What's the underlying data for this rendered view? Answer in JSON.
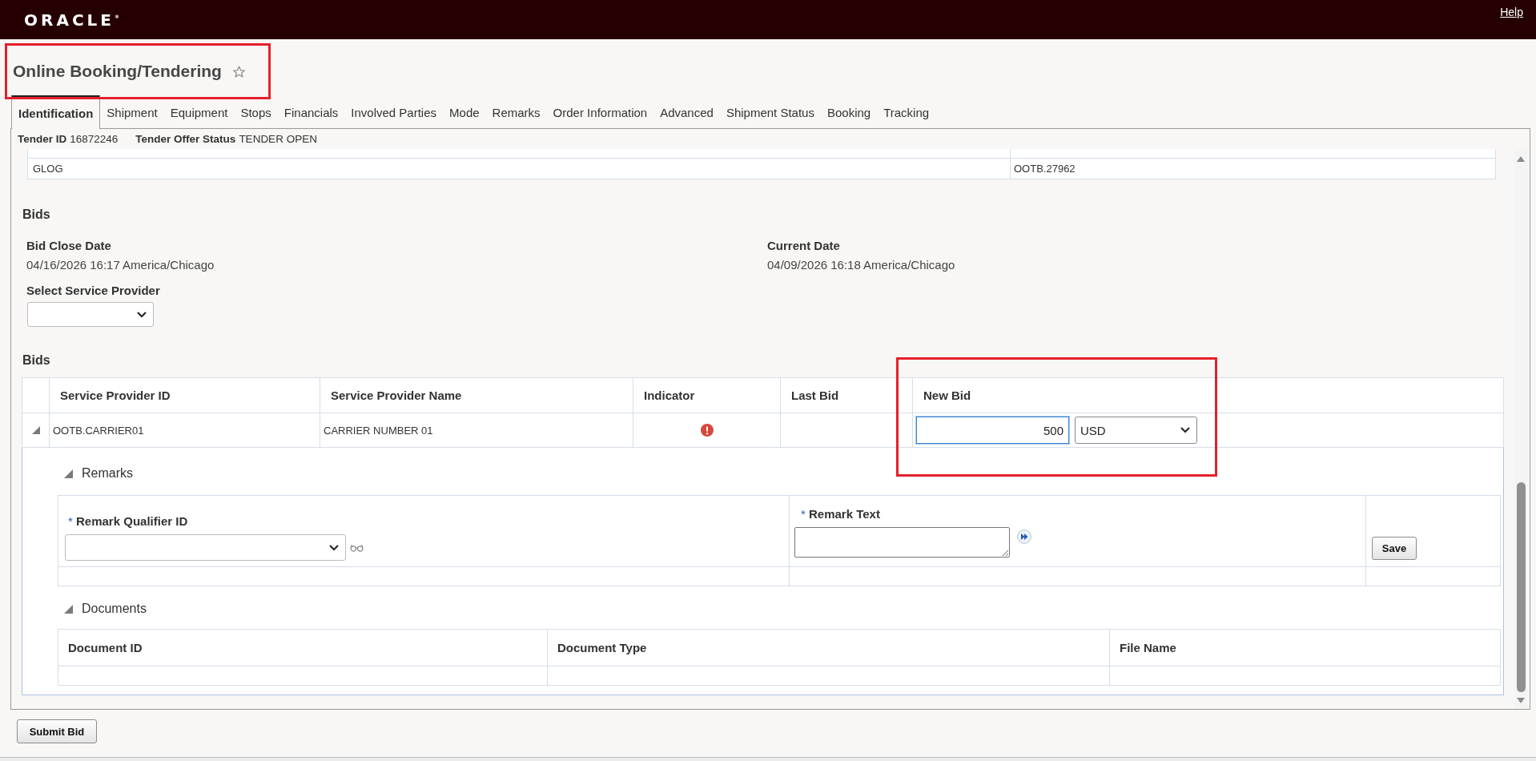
{
  "header": {
    "logo": "ORACLE$^{®}$",
    "help_link": "Help"
  },
  "page_title": {
    "text": "Online Booking/Tendering",
    "favorite": false,
    "highlighted": true
  },
  "tabs": [
    {
      "label": "Identification",
      "selected": true
    },
    {
      "label": "Shipment",
      "selected": false
    },
    {
      "label": "Equipment",
      "selected": false
    },
    {
      "label": "Stops",
      "selected": false
    },
    {
      "label": "Financials",
      "selected": false
    },
    {
      "label": "Involved Parties",
      "selected": false
    },
    {
      "label": "Mode",
      "selected": false
    },
    {
      "label": "Remarks",
      "selected": false
    },
    {
      "label": "Order Information",
      "selected": false
    },
    {
      "label": "Advanced",
      "selected": false
    },
    {
      "label": "Shipment Status",
      "selected": false
    },
    {
      "label": "Booking",
      "selected": false
    },
    {
      "label": "Tracking",
      "selected": false
    }
  ],
  "summary": [
    {
      "label": "Tender ID",
      "value": "16872246"
    },
    {
      "label": "Tender Offer Status",
      "value": "TENDER OPEN"
    }
  ],
  "upper_table": {
    "rows": [
      {
        "column_1": "GLOG",
        "column_2": "OOTB.27962"
      }
    ]
  },
  "bid_info": {
    "heading": "Bids",
    "fields": [
      {
        "label": "Bid Close Date",
        "value": "04/16/2026 16:17 America/Chicago"
      },
      {
        "label": "Current Date",
        "value": "04/09/2026 16:18 America/Chicago"
      }
    ],
    "service_provider_select": {
      "label": "Select Service Provider"
    }
  },
  "bids_table": {
    "heading": "Bids",
    "columns": [
      {
        "label": "Service Provider ID",
        "highlighted": false
      },
      {
        "label": "Service Provider Name",
        "highlighted": false
      },
      {
        "label": "Indicator",
        "highlighted": false
      },
      {
        "label": "Last Bid",
        "highlighted": false
      },
      {
        "label": "New Bid",
        "highlighted": true
      }
    ],
    "rows": [
      {
        "expanded": true,
        "service_provider_id": "OOTB.CARRIER01",
        "service_provider_name": "CARRIER NUMBER 01",
        "has_error": true,
        "new_bid": {
          "value": "500",
          "focused": true
        },
        "currency": "USD",
        "remarks": {
          "heading": "Remarks",
          "expanded": true,
          "fields": [
            {
              "kind": "select",
              "required_mark": "*",
              "label": "Remark Qualifier ID"
            },
            {
              "kind": "textarea",
              "required_mark": "*",
              "label": "Remark Text"
            }
          ],
          "save_button": "Save"
        },
        "documents": {
          "heading": "Documents",
          "expanded": true,
          "columns": [
            "Document ID",
            "Document Type",
            "File Name"
          ]
        }
      }
    ]
  },
  "submit_button": "Submit Bid"
}
